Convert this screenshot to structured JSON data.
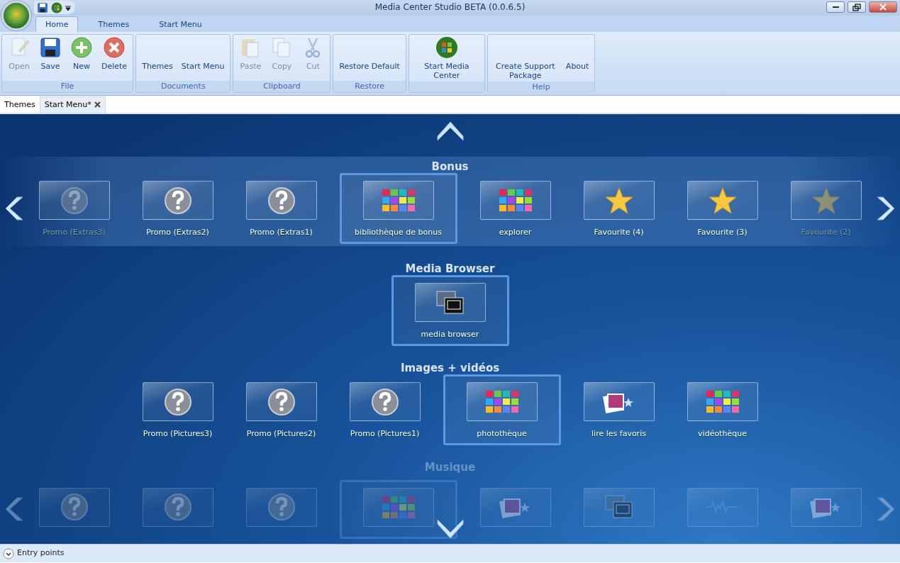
{
  "window": {
    "title": "Media Center Studio BETA (0.0.6.5)"
  },
  "ribbon_tabs": [
    {
      "label": "Home",
      "selected": true
    },
    {
      "label": "Themes",
      "selected": false
    },
    {
      "label": "Start Menu",
      "selected": false
    }
  ],
  "ribbon_groups": [
    {
      "label": "File",
      "buttons": [
        {
          "label": "Open",
          "disabled": true
        },
        {
          "label": "Save",
          "disabled": false
        },
        {
          "label": "New",
          "disabled": false
        },
        {
          "label": "Delete",
          "disabled": false
        }
      ]
    },
    {
      "label": "Documents",
      "buttons": [
        {
          "label": "Themes",
          "disabled": false
        },
        {
          "label": "Start Menu",
          "disabled": false
        }
      ]
    },
    {
      "label": "Clipboard",
      "buttons": [
        {
          "label": "Paste",
          "disabled": true
        },
        {
          "label": "Copy",
          "disabled": true
        },
        {
          "label": "Cut",
          "disabled": true
        }
      ]
    },
    {
      "label": "Restore",
      "buttons": [
        {
          "label": "Restore Default",
          "disabled": false
        }
      ]
    },
    {
      "buttons": [
        {
          "label": "Start Media Center",
          "disabled": false
        }
      ]
    },
    {
      "label": "Help",
      "buttons": [
        {
          "label": "Create Support Package",
          "disabled": false
        },
        {
          "label": "About",
          "disabled": false
        }
      ]
    }
  ],
  "document_tabs": [
    {
      "label": "Themes",
      "selected": false,
      "closable": false
    },
    {
      "label": "Start Menu*",
      "selected": true,
      "closable": true
    }
  ],
  "sections": [
    {
      "title": "Bonus",
      "band": true,
      "arrows": true,
      "faded": false,
      "items": [
        {
          "label": "Promo (Extras3)",
          "kind": "question",
          "selected": false,
          "dimmed": true
        },
        {
          "label": "Promo (Extras2)",
          "kind": "question",
          "selected": false,
          "dimmed": false
        },
        {
          "label": "Promo (Extras1)",
          "kind": "question",
          "selected": false,
          "dimmed": false
        },
        {
          "label": "bibliothèque de bonus",
          "kind": "tiles",
          "selected": true,
          "dimmed": false
        },
        {
          "label": "explorer",
          "kind": "tiles",
          "selected": false,
          "dimmed": false
        },
        {
          "label": "Favourite (4)",
          "kind": "star",
          "selected": false,
          "dimmed": false
        },
        {
          "label": "Favourite (3)",
          "kind": "star",
          "selected": false,
          "dimmed": false
        },
        {
          "label": "Favourite (2)",
          "kind": "star",
          "selected": false,
          "dimmed": true
        }
      ]
    },
    {
      "title": "Media Browser",
      "band": false,
      "arrows": false,
      "faded": false,
      "items": [
        {
          "label": "media browser",
          "kind": "media",
          "selected": true
        }
      ]
    },
    {
      "title": "Images + vidéos",
      "band": false,
      "arrows": false,
      "faded": false,
      "items": [
        {
          "label": "Promo (Pictures3)",
          "kind": "question",
          "selected": false
        },
        {
          "label": "Promo (Pictures2)",
          "kind": "question",
          "selected": false
        },
        {
          "label": "Promo (Pictures1)",
          "kind": "question",
          "selected": false
        },
        {
          "label": "photothèque",
          "kind": "tiles",
          "selected": true
        },
        {
          "label": "lire les favoris",
          "kind": "photos",
          "selected": false
        },
        {
          "label": "vidéothèque",
          "kind": "tiles",
          "selected": false
        }
      ]
    },
    {
      "title": "Musique",
      "band": false,
      "arrows": true,
      "faded": true,
      "items": [
        {
          "kind": "question",
          "selected": false
        },
        {
          "kind": "question",
          "selected": false
        },
        {
          "kind": "question",
          "selected": false
        },
        {
          "kind": "tiles",
          "selected": true
        },
        {
          "kind": "photos",
          "selected": false
        },
        {
          "kind": "media",
          "selected": false
        },
        {
          "kind": "wave",
          "selected": false
        },
        {
          "kind": "photos",
          "selected": false
        }
      ]
    }
  ],
  "status_bar": {
    "label": "Entry points",
    "expanded": false
  }
}
